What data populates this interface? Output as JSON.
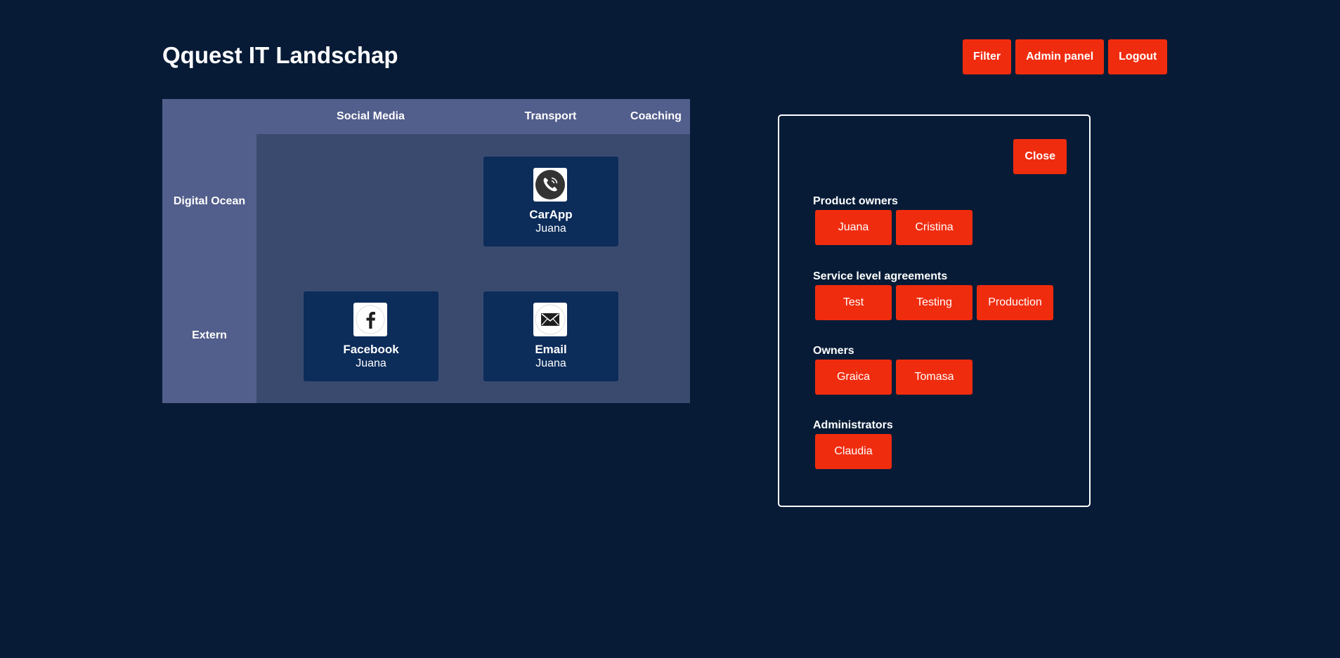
{
  "header": {
    "title": "Qquest IT Landschap",
    "filter_label": "Filter",
    "admin_label": "Admin panel",
    "logout_label": "Logout"
  },
  "grid": {
    "columns": [
      "Social Media",
      "Transport",
      "Coaching"
    ],
    "rows": [
      "Digital Ocean",
      "Extern"
    ],
    "apps": [
      {
        "name": "CarApp",
        "owner": "Juana",
        "icon": "phone-icon",
        "row": "Digital Ocean",
        "column": "Transport"
      },
      {
        "name": "Facebook",
        "owner": "Juana",
        "icon": "facebook-icon",
        "row": "Extern",
        "column": "Social Media"
      },
      {
        "name": "Email",
        "owner": "Juana",
        "icon": "envelope-icon",
        "row": "Extern",
        "column": "Transport"
      }
    ]
  },
  "panel": {
    "close_label": "Close",
    "sections": [
      {
        "title": "Product owners",
        "items": [
          "Juana",
          "Cristina"
        ]
      },
      {
        "title": "Service level agreements",
        "items": [
          "Test",
          "Testing",
          "Production"
        ]
      },
      {
        "title": "Owners",
        "items": [
          "Graica",
          "Tomasa"
        ]
      },
      {
        "title": "Administrators",
        "items": [
          "Claudia"
        ]
      }
    ]
  },
  "colors": {
    "background": "#071b36",
    "accent": "#f02c0f",
    "header_cell": "#525e8b",
    "grid_cell": "#3a4a6f",
    "card": "#0c2c5a"
  }
}
